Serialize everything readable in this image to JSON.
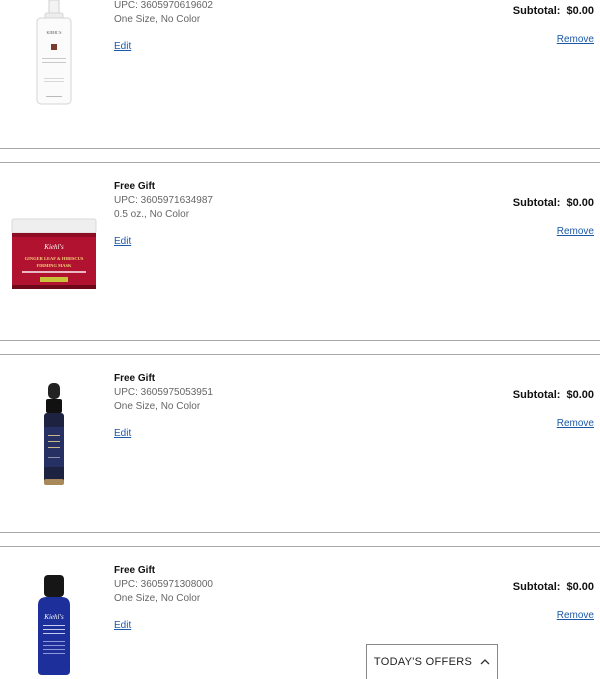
{
  "items": [
    {
      "gift_label": "",
      "upc": "UPC: 3605970619602",
      "variant": "One Size, No Color",
      "edit_label": "Edit",
      "subtotal_label": "Subtotal:",
      "subtotal_value": "$0.00",
      "remove_label": "Remove",
      "image": "serum-pump-bottle"
    },
    {
      "gift_label": "Free Gift",
      "upc": "UPC: 3605971634987",
      "variant": "0.5 oz., No Color",
      "edit_label": "Edit",
      "subtotal_label": "Subtotal:",
      "subtotal_value": "$0.00",
      "remove_label": "Remove",
      "image": "ginger-leaf-hibiscus-mask-jar",
      "image_text": [
        "Kiehl's",
        "GINGER LEAF & HIBISCUS",
        "FIRMING MASK"
      ]
    },
    {
      "gift_label": "Free Gift",
      "upc": "UPC: 3605975053951",
      "variant": "One Size, No Color",
      "edit_label": "Edit",
      "subtotal_label": "Subtotal:",
      "subtotal_value": "$0.00",
      "remove_label": "Remove",
      "image": "dropper-bottle"
    },
    {
      "gift_label": "Free Gift",
      "upc": "UPC: 3605971308000",
      "variant": "One Size, No Color",
      "edit_label": "Edit",
      "subtotal_label": "Subtotal:",
      "subtotal_value": "$0.00",
      "remove_label": "Remove",
      "image": "blue-bottle",
      "image_text": [
        "Kiehl's"
      ]
    }
  ],
  "offers_button": {
    "label": "TODAY'S OFFERS",
    "icon": "chevron-up-icon"
  },
  "colors": {
    "link": "#1a5aa8",
    "divider": "#a8a8a8",
    "mask_red": "#b0122f",
    "bottle_blue": "#1c2f9a"
  }
}
